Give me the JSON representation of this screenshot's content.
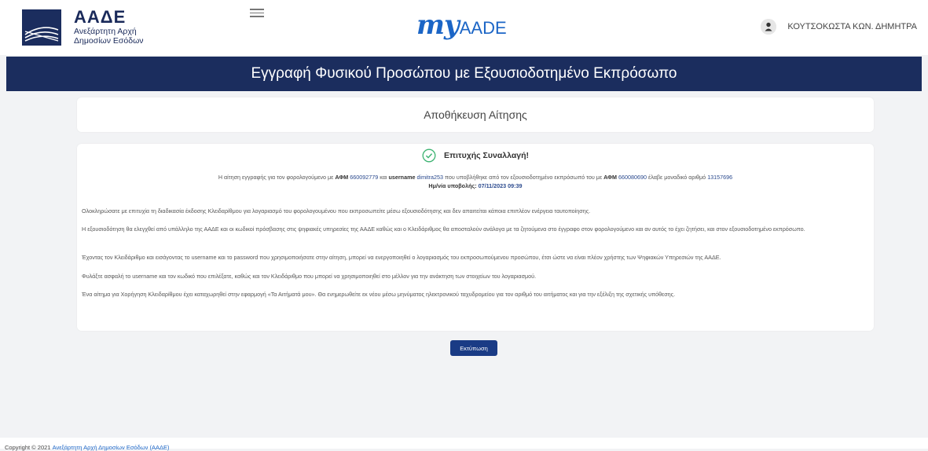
{
  "header": {
    "logo_title": "ΑΑΔΕ",
    "logo_sub_line1": "Ανεξάρτητη Αρχή",
    "logo_sub_line2": "Δημοσίων Εσόδων",
    "brand_my": "my",
    "brand_aade": "AADE",
    "user_name": "ΚΟΥΤΣΟΚΩΣΤΑ ΚΩΝ. ΔΗΜΗΤΡΑ"
  },
  "banner": {
    "title": "Εγγραφή Φυσικού Προσώπου με Εξουσιοδοτημένο Εκπρόσωπο"
  },
  "save_card": {
    "title": "Αποθήκευση Αίτησης"
  },
  "result": {
    "success_title": "Επιτυχής Συναλλαγή!",
    "s1": "Η αίτηση εγγραφής για τον φορολογούμενο με",
    "afm_label1": "ΑΦΜ",
    "afm1": "660092779",
    "s2": "και",
    "username_label": "username",
    "username": "dimitra253",
    "s3": "που υποβλήθηκε από τον εξουσιοδοτημένο εκπρόσωπό του με",
    "afm_label2": "ΑΦΜ",
    "afm2": "660080690",
    "s4": "έλαβε μοναδικό αριθμό",
    "app_number": "13157696",
    "date_label": "Ημ/νία υποβολής:",
    "date_value": "07/11/2023 09:39"
  },
  "paragraphs": [
    "Ολοκληρώσατε με επιτυχία τη διαδικασία έκδοσης Κλειδαρίθμου για λογαριασμό του φορολογουμένου που εκπροσωπείτε μέσω εξουσιοδότησης και δεν απαιτείται κάποια επιπλέον ενέργεια ταυτοποίησης.",
    "Η εξουσιοδότηση θα ελεγχθεί από υπάλληλο της ΑΑΔΕ και οι κωδικοί πρόσβασης στις ψηφιακές υπηρεσίες της ΑΑΔΕ καθώς και ο Κλειδάριθμος θα αποσταλούν ανάλογα με τα ζητούμενα στο έγγραφο στον φορολογούμενο και αν αυτός το έχει ζητήσει, και στον εξουσιοδοτημένο εκπρόσωπο.",
    "Έχοντας τον Κλειδάριθμο και εισάγοντας το username και το password που χρησιμοποιήσατε στην αίτηση, μπορεί να ενεργοποιηθεί ο λογαριασμός του εκπροσωπούμενου προσώπου, έτσι ώστε να είναι πλέον χρήστης των Ψηφιακών Υπηρεσιών της ΑΑΔΕ.",
    "Φυλάξτε ασφαλή το username και τον κωδικό που επιλέξατε, καθώς και τον Κλειδάριθμο που μπορεί να χρησιμοποιηθεί στο μέλλον για την ανάκτηση των στοιχείων του λογαριασμού.",
    "Ένα αίτημα για Χορήγηση Κλειδαρίθμου έχει καταχωρηθεί στην εφαρμογή «Τα Αιτήματά μου». Θα ενημερωθείτε εκ νέου μέσω μηνύματος ηλεκτρονικού ταχυδρομείου για τον αριθμό του αιτήματος και για την εξέλιξη της σχετικής υπόθεσης."
  ],
  "print_button": "Εκτύπωση",
  "footer": {
    "prefix": "Copyright © 2021",
    "link": "Ανεξάρτητη Αρχή Δημοσίων Εσόδων (ΑΑΔΕ)"
  },
  "icons": {
    "logo": "aade-wave-logo",
    "menu": "hamburger-icon",
    "user": "user-avatar-icon",
    "success": "check-circle-icon"
  },
  "colors": {
    "banner": "#1b2d5e",
    "brand": "#1b65c6",
    "success": "#3cb371",
    "button": "#1a3b85"
  }
}
